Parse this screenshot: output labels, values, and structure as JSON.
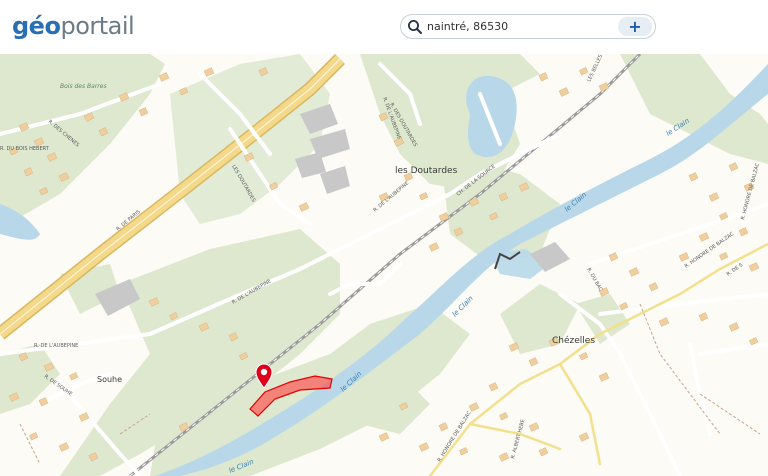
{
  "header": {
    "logo_geo": "géo",
    "logo_portail": "portail",
    "search_value": "naintré, 86530",
    "add_label": "+"
  },
  "map": {
    "places": {
      "les_doutardes": "les Doutardes",
      "chezelles": "Chézelles",
      "souhe": "Souhe"
    },
    "water": {
      "le_clain_1": "le Clain",
      "le_clain_2": "le Clain",
      "le_clain_3": "le Clain",
      "le_clain_4": "le Clain",
      "le_clain_5": "le Clain"
    },
    "woods": {
      "bois_des_barres": "Bois des Barres"
    },
    "streets": {
      "r_de_paris": "R. DE PARIS",
      "r_de_l_aubepine_1": "R. DE L'AUBEPINE",
      "r_de_l_aubepine_2": "R. DE L'AUBEPINE",
      "r_de_l_aubepine_3": "R. DE L'AUBEPINE",
      "r_de_l_aubepine_4": "R. DE L'AUBEPINE",
      "ch_de_la_source": "CH. DE LA SOURCE",
      "les_doutardes_street": "LES DOUTARDES",
      "r_des_doutardes": "R. DES DOUTARDES",
      "les_belles": "LES BELLES",
      "r_des_chenes": "R. DES CHENES",
      "r_du_bois_hebert": "R. DU BOIS HEBERT",
      "r_de_souhe": "R. DE SOUHE",
      "r_honore_de_balzac_1": "R. HONORE DE BALZAC",
      "r_honore_de_balzac_2": "R. HONORE DE BALZAC",
      "r_honore_de_balzac_3": "R. HONORE DE BALZAC",
      "r_du_bac": "R. DU BAC",
      "r_albert_hebe": "R. ALBERT HEBE",
      "r_de_s": "R. DE S"
    }
  },
  "colors": {
    "background": "#fdfbf6",
    "forest": "#dde8cf",
    "water": "#b8d8ea",
    "highway": "#f0d080",
    "road_main": "#f2e08c",
    "building": "#f0cf9f",
    "building_public": "#c8c8c8",
    "parcel": "#ff3b3b",
    "marker": "#e0001b"
  }
}
